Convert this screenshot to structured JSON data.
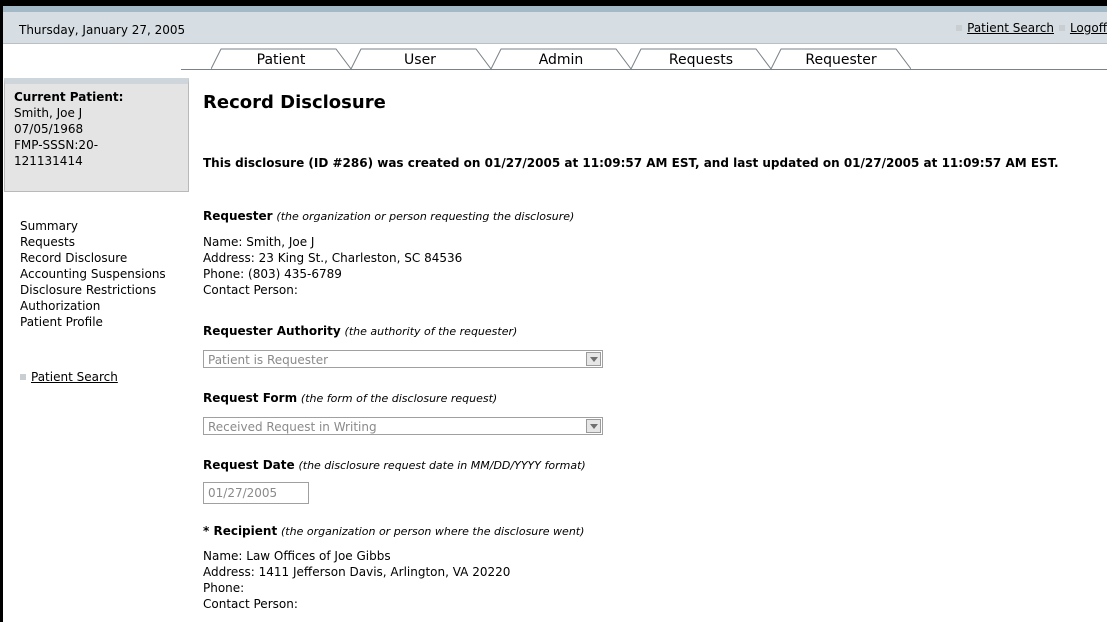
{
  "header": {
    "date": "Thursday, January 27, 2005",
    "links": [
      {
        "label": "Patient Search"
      },
      {
        "label": "Logoff"
      }
    ]
  },
  "tabs": [
    {
      "label": "Patient"
    },
    {
      "label": "User"
    },
    {
      "label": "Admin"
    },
    {
      "label": "Requests"
    },
    {
      "label": "Requester"
    }
  ],
  "sidebar": {
    "current_patient_label": "Current Patient:",
    "patient_name": "Smith, Joe J",
    "patient_dob": "07/05/1968",
    "patient_id_line1": "FMP-SSSN:20-",
    "patient_id_line2": "121131414",
    "nav": [
      {
        "label": "Summary"
      },
      {
        "label": "Requests"
      },
      {
        "label": "Record Disclosure"
      },
      {
        "label": "Accounting Suspensions"
      },
      {
        "label": "Disclosure Restrictions"
      },
      {
        "label": "Authorization"
      },
      {
        "label": "Patient Profile"
      }
    ],
    "search_link": "Patient Search"
  },
  "main": {
    "title": "Record Disclosure",
    "info_line": "This disclosure (ID #286) was created on 01/27/2005 at 11:09:57 AM EST, and last updated on 01/27/2005 at 11:09:57 AM EST.",
    "requester": {
      "heading": "Requester",
      "hint": "(the organization or person requesting the disclosure)",
      "name": "Name: Smith, Joe J",
      "address": "Address: 23 King St., Charleston, SC 84536",
      "phone": "Phone: (803) 435-6789",
      "contact": "Contact Person:"
    },
    "authority": {
      "heading": "Requester Authority",
      "hint": "(the authority of the requester)",
      "value": "Patient is Requester"
    },
    "request_form": {
      "heading": "Request Form",
      "hint": "(the form of the disclosure request)",
      "value": "Received Request in Writing"
    },
    "request_date": {
      "heading": "Request Date",
      "hint": "(the disclosure request date in MM/DD/YYYY format)",
      "value": "01/27/2005"
    },
    "recipient": {
      "heading": "* Recipient",
      "hint": "(the organization or person where the disclosure went)",
      "name": "Name: Law Offices of Joe Gibbs",
      "address": "Address: 1411 Jefferson Davis, Arlington, VA 20220",
      "phone": "Phone:",
      "contact": "Contact Person:"
    }
  }
}
